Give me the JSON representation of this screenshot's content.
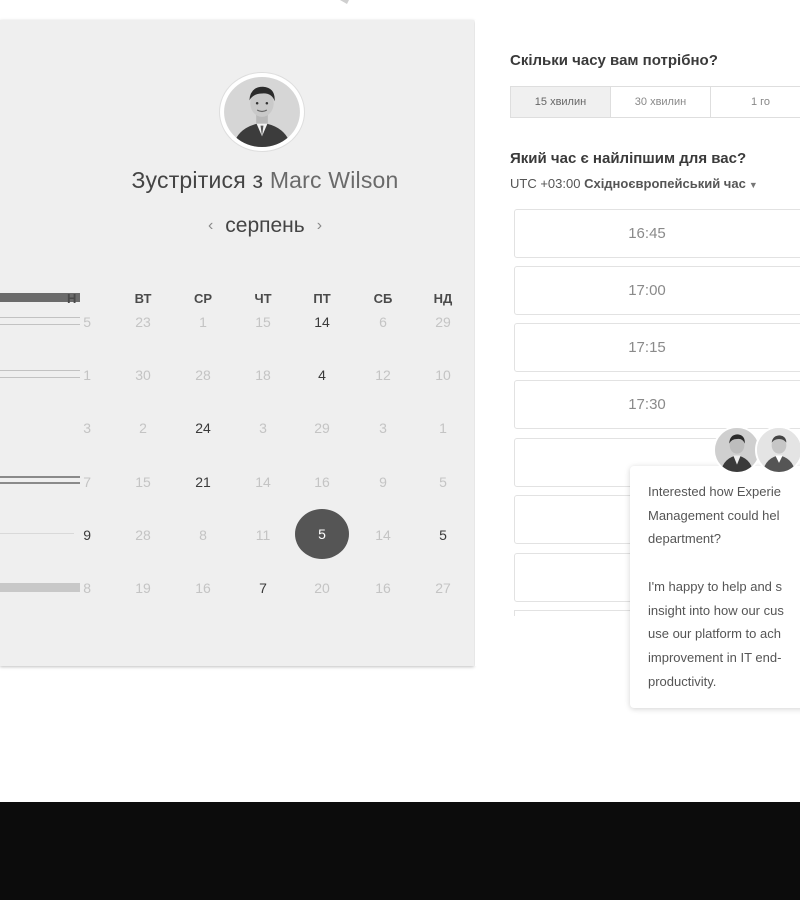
{
  "meeting": {
    "title_prefix": "Зустрітися з ",
    "host_name": "Marc Wilson"
  },
  "calendar": {
    "month": "серпень",
    "prev_icon": "chevron-left-icon",
    "next_icon": "chevron-right-icon",
    "weekdays": [
      "Н",
      "ВТ",
      "СР",
      "ЧТ",
      "ПТ",
      "СБ",
      "НД"
    ],
    "weeks": [
      [
        "5",
        "23",
        "1",
        "15",
        "14",
        "6",
        "29"
      ],
      [
        "1",
        "30",
        "28",
        "18",
        "4",
        "12",
        "10"
      ],
      [
        "3",
        "2",
        "24",
        "3",
        "29",
        "3",
        "1"
      ],
      [
        "7",
        "15",
        "21",
        "14",
        "16",
        "9",
        "5"
      ],
      [
        "9",
        "28",
        "8",
        "11",
        "5",
        "14",
        "5"
      ],
      [
        "8",
        "19",
        "16",
        "7",
        "20",
        "16",
        "27"
      ]
    ],
    "available": [
      [
        4
      ],
      [
        4
      ],
      [
        2
      ],
      [
        2
      ],
      [
        0,
        6
      ],
      [
        3
      ]
    ],
    "selected_day": "5"
  },
  "booking": {
    "duration_question": "Скільки часу вам потрібно?",
    "durations": [
      "15 хвилин",
      "30 хвилин",
      "1 го"
    ],
    "active_duration": "15 хвилин",
    "time_question": "Який час є найліпшим для вас?",
    "timezone_offset": "UTC +03:00",
    "timezone_name": "Східноєвропейський час",
    "timezone_caret_icon": "caret-down-icon",
    "slots": [
      "16:45",
      "17:00",
      "17:15",
      "17:30"
    ]
  },
  "chat": {
    "paragraph1": [
      "Interested how Experie",
      "Management could hel",
      "department?"
    ],
    "paragraph2": [
      "I'm happy to help and s",
      "insight into how our cus",
      "use our platform to ach",
      "improvement in IT end-",
      "productivity."
    ]
  },
  "colors": {
    "panel_bg": "#efefef",
    "selected_day_bg": "#555555",
    "footer_bg": "#0c0c0c"
  }
}
